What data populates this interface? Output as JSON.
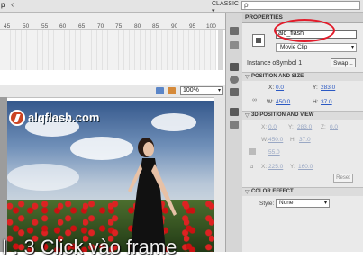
{
  "top_bar": {
    "fragment": "p",
    "workspace": "CLASSIC",
    "workspace_arrow": "▾",
    "search_icon": "ρ"
  },
  "timeline": {
    "ruler_ticks": [
      "45",
      "50",
      "55",
      "60",
      "65",
      "70",
      "75",
      "80",
      "85",
      "90",
      "95",
      "100"
    ]
  },
  "stage_toolbar": {
    "scene_icon": "edit-scene-icon",
    "symbol_icon": "edit-symbol-icon",
    "zoom": "100%"
  },
  "stage": {
    "logo_text": "alqflash.com"
  },
  "caption": "I            . 3              Click vào frame",
  "properties": {
    "title": "PROPERTIES",
    "instance_name": "alq_flash",
    "symbol_type": "Movie Clip",
    "instance_of_label": "Instance of:",
    "instance_of_value": "Symbol 1",
    "swap_label": "Swap...",
    "position_size": {
      "heading": "POSITION AND SIZE",
      "x_label": "X:",
      "x": "0.0",
      "y_label": "Y:",
      "y": "283.0",
      "w_label": "W:",
      "w": "450.0",
      "h_label": "H:",
      "h": "37.0"
    },
    "position_view_3d": {
      "heading": "3D POSITION AND VIEW",
      "x_label": "X:",
      "x": "0.0",
      "y_label": "Y:",
      "y": "283.0",
      "z_label": "Z:",
      "z": "0.0",
      "w_label": "W:",
      "w": "450.0",
      "h_label": "H:",
      "h": "37.0",
      "fov": "55.0",
      "vx_label": "X:",
      "vx": "225.0",
      "vy_label": "Y:",
      "vy": "160.0",
      "reset_label": "Reset"
    },
    "color_effect": {
      "heading": "COLOR EFFECT",
      "style_label": "Style:",
      "style_value": "None"
    }
  },
  "colors": {
    "panel_bg": "#eaeaea",
    "value_link": "#2b59c3",
    "highlight_ellipse": "#e21b2a"
  }
}
